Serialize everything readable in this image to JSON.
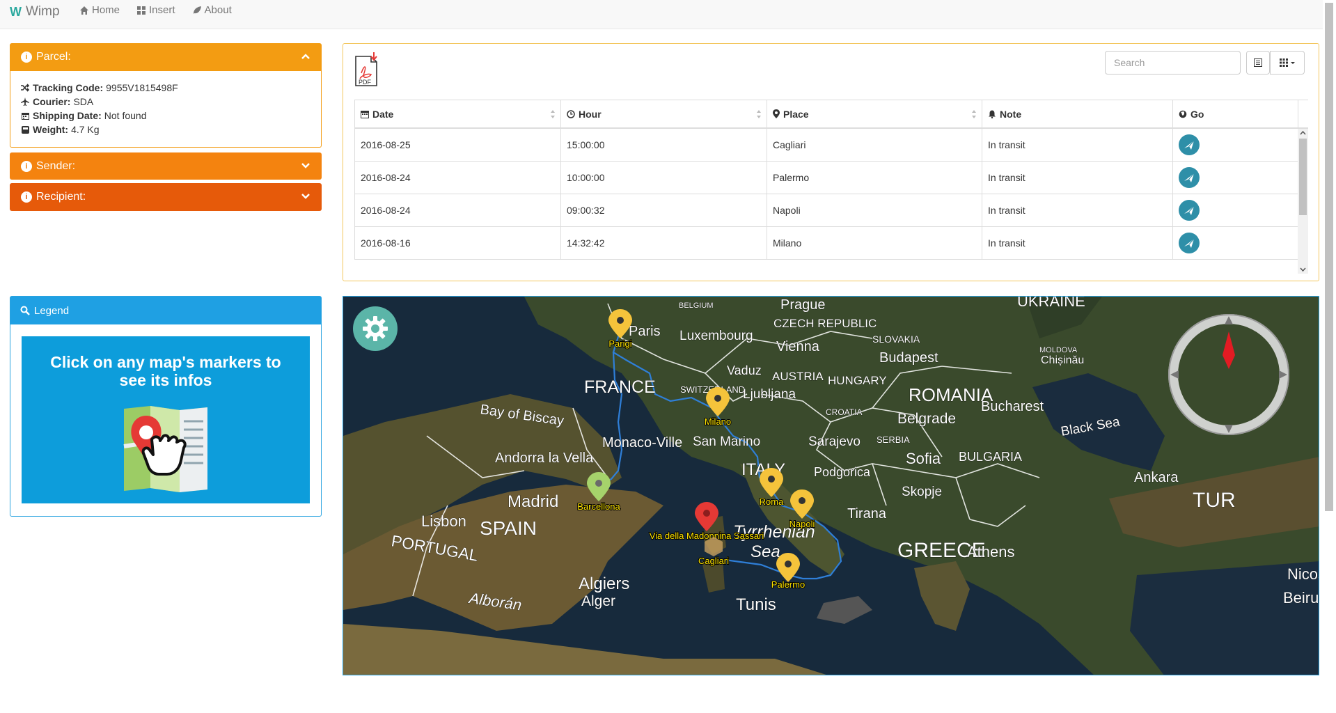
{
  "navbar": {
    "brand": "Wimp",
    "links": [
      {
        "label": "Home",
        "icon": "home-icon"
      },
      {
        "label": "Insert",
        "icon": "grid-icon"
      },
      {
        "label": "About",
        "icon": "leaf-icon"
      }
    ]
  },
  "parcel": {
    "title": "Parcel:",
    "tracking_label": "Tracking Code:",
    "tracking_value": "9955V1815498F",
    "courier_label": "Courier:",
    "courier_value": "SDA",
    "shipping_label": "Shipping Date:",
    "shipping_value": "Not found",
    "weight_label": "Weight:",
    "weight_value": "4.7 Kg"
  },
  "sender": {
    "title": "Sender:"
  },
  "recipient": {
    "title": "Recipient:"
  },
  "legend": {
    "title": "Legend",
    "text": "Click on any map's markers to see its infos"
  },
  "toolbar": {
    "search_placeholder": "Search",
    "pdf_label": "PDF"
  },
  "table": {
    "columns": [
      "Date",
      "Hour",
      "Place",
      "Note",
      "Go"
    ],
    "rows": [
      {
        "date": "2016-08-25",
        "hour": "15:00:00",
        "place": "Cagliari",
        "note": "In transit"
      },
      {
        "date": "2016-08-24",
        "hour": "10:00:00",
        "place": "Palermo",
        "note": "In transit"
      },
      {
        "date": "2016-08-24",
        "hour": "09:00:32",
        "place": "Napoli",
        "note": "In transit"
      },
      {
        "date": "2016-08-16",
        "hour": "14:32:42",
        "place": "Milano",
        "note": "In transit"
      }
    ]
  },
  "map": {
    "markers": [
      {
        "label": "Parigi",
        "color": "#f5c33b"
      },
      {
        "label": "Milano",
        "color": "#f5c33b"
      },
      {
        "label": "Barcellona",
        "color": "#a6d36b"
      },
      {
        "label": "Roma",
        "color": "#f5c33b"
      },
      {
        "label": "Napoli",
        "color": "#f5c33b"
      },
      {
        "label": "Via della Madonnina Sassari",
        "color": "#e53935"
      },
      {
        "label": "Cagliari",
        "color": "#f5c33b"
      },
      {
        "label": "Palermo",
        "color": "#f5c33b"
      }
    ],
    "place_names": [
      "Paris",
      "Luxembourg",
      "Prague",
      "CZECH REPUBLIC",
      "Vienna",
      "SLOVAKIA",
      "Budapest",
      "UKRAINE",
      "MOLDOVA",
      "Chișinău",
      "FRANCE",
      "SWITZERLAND",
      "Vaduz",
      "AUSTRIA",
      "Ljubljana",
      "HUNGARY",
      "ROMANIA",
      "Bay of Biscay",
      "CROATIA",
      "Belgrade",
      "Bucharest",
      "Black Sea",
      "Monaco-Ville",
      "San Marino",
      "Sarajevo",
      "SERBIA",
      "Sofia",
      "BULGARIA",
      "Andorra la Vella",
      "ITALY",
      "Podgorica",
      "Madrid",
      "Ankara",
      "SPAIN",
      "Skopje",
      "TUR",
      "Lisbon",
      "Tyrrhenian",
      "Tirana",
      "PORTUGAL",
      "Sea",
      "GREECE",
      "Athens",
      "Nicosia",
      "Algiers",
      "Alger",
      "Alborán",
      "Tunis",
      "Beirut",
      "BELGIUM"
    ],
    "colors": {
      "route": "#2f7fd8",
      "accent_orange": "#f39c12",
      "legend_blue": "#1fa0e3"
    }
  }
}
